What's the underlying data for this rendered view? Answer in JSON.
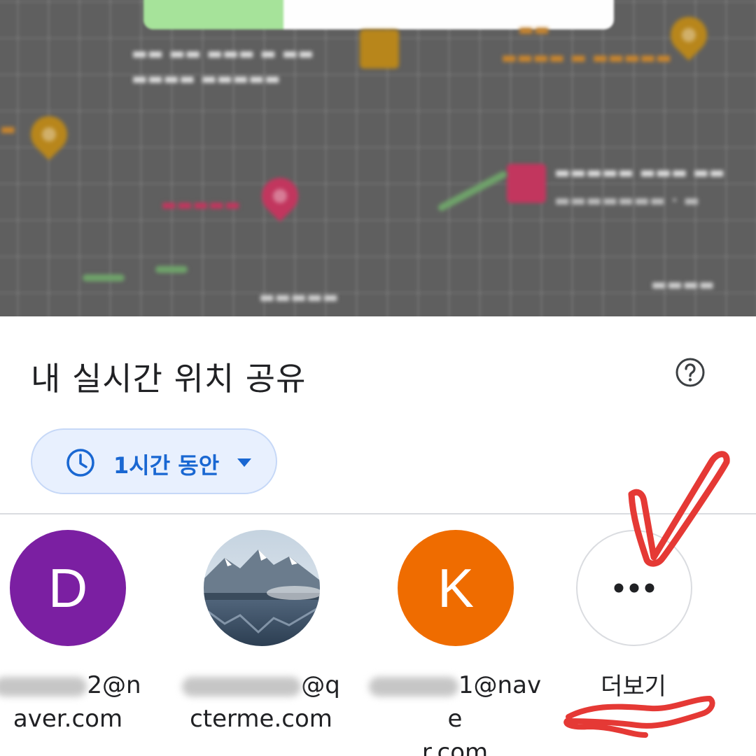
{
  "sheet": {
    "title": "내 실시간 위치 공유",
    "help_icon": "help-circle-icon",
    "duration": {
      "label": "1시간 동안",
      "icon": "clock-icon",
      "dropdown_icon": "arrow-drop-down-icon"
    }
  },
  "contacts": [
    {
      "avatar_letter": "D",
      "avatar_color": "#7b1fa2",
      "email_visible_start": "2@n",
      "email_visible_end": "aver.com"
    },
    {
      "avatar_type": "landscape-photo",
      "email_visible_start": "@q",
      "email_visible_end": "cterme.com"
    },
    {
      "avatar_letter": "K",
      "avatar_color": "#ef6c00",
      "email_visible_start": "1@nave",
      "email_visible_end": "r.com"
    },
    {
      "more_icon": "more-horizontal-icon",
      "label": "더보기"
    }
  ],
  "colors": {
    "accent_blue": "#1967d2",
    "chip_background": "#e8f0fe",
    "annotation_red": "#e53935"
  }
}
